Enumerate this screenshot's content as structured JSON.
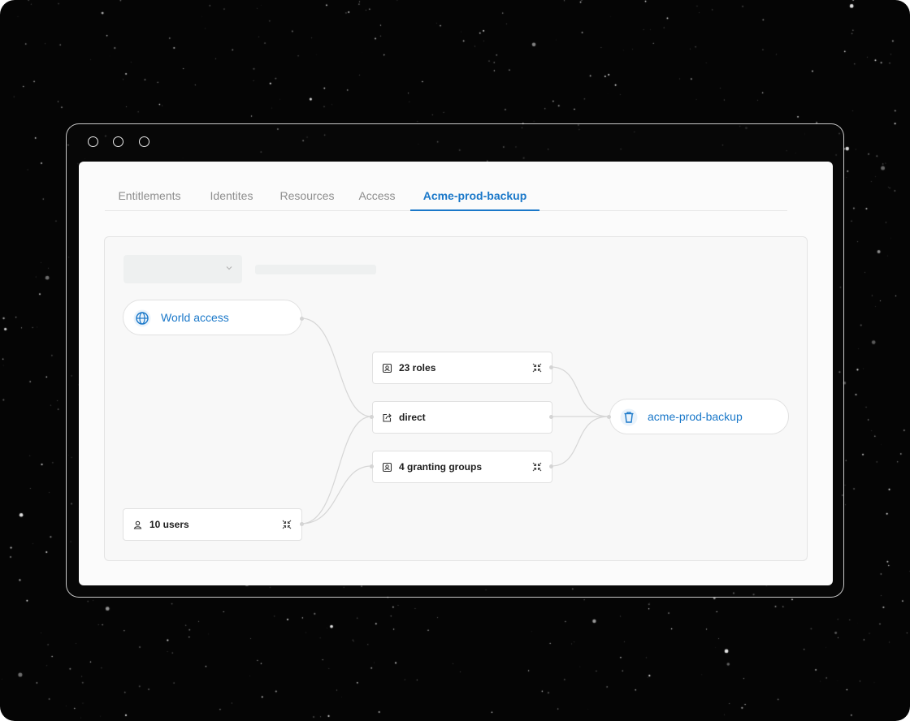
{
  "window": {
    "controls": [
      "window-dot",
      "window-dot",
      "window-dot"
    ]
  },
  "tabs": [
    {
      "label": "Entitlements",
      "active": false
    },
    {
      "label": "Identites",
      "active": false
    },
    {
      "label": "Resources",
      "active": false
    },
    {
      "label": "Access",
      "active": false
    },
    {
      "label": "Acme-prod-backup",
      "active": true
    }
  ],
  "toolbar": {
    "dropdown_value": "",
    "dropdown_icon": "chevron-down-icon"
  },
  "graph": {
    "world_access": {
      "label": "World access",
      "icon": "globe-icon"
    },
    "users": {
      "label": "10 users",
      "icon": "user-icon"
    },
    "roles": {
      "label": "23 roles",
      "icon": "id-badge-icon"
    },
    "direct": {
      "label": "direct",
      "icon": "share-arrow-icon"
    },
    "granting_groups": {
      "label": "4 granting groups",
      "icon": "id-badge-icon"
    },
    "resource": {
      "label": "acme-prod-backup",
      "icon": "trash-bucket-icon"
    }
  },
  "colors": {
    "accent": "#1a78c9",
    "background": "#050505",
    "panel": "#fbfbfb",
    "edge": "#d6d6d6"
  }
}
